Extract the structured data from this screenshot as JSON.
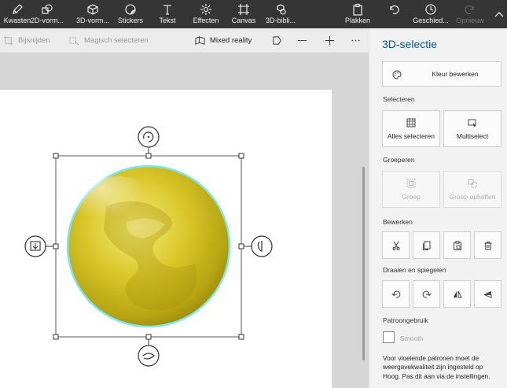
{
  "ribbon": {
    "tools": [
      {
        "label": "Kwasten",
        "icon": "brush-icon"
      },
      {
        "label": "2D-vorm...",
        "icon": "2d-shapes-icon"
      },
      {
        "label": "3D-vorm...",
        "icon": "3d-shapes-icon"
      },
      {
        "label": "Stickers",
        "icon": "sticker-icon"
      },
      {
        "label": "Tekst",
        "icon": "text-icon"
      },
      {
        "label": "Effecten",
        "icon": "effects-icon"
      },
      {
        "label": "Canvas",
        "icon": "canvas-icon"
      },
      {
        "label": "3D-bibli...",
        "icon": "3d-library-icon"
      }
    ],
    "paste": "Plakken",
    "undo": "",
    "history": "Geschied...",
    "redo": "Opnieuw"
  },
  "subbar": {
    "crop": "Bijsnijden",
    "magic_select": "Magisch selecteren",
    "mixed_reality": "Mixed reality"
  },
  "panel": {
    "title": "3D-selectie",
    "edit_color": "Kleur bewerken",
    "select_heading": "Selecteren",
    "select_all": "Alles selecteren",
    "multiselect": "Multiselect",
    "group_heading": "Groeperen",
    "group": "Groep",
    "ungroup": "Groep opheffen",
    "edit_heading": "Bewerken",
    "rotate_heading": "Draaien en spiegelen",
    "pattern_heading": "Patroongebruik",
    "smooth_label": "Smooth",
    "smooth_checked": false,
    "note": "Voor vloeiende patronen moet de weergavekwaliteit zijn ingesteld op Hoog. Pas dit aan via de instellingen."
  },
  "colors": {
    "accent": "#0b5394",
    "sphere": "#d4c41a",
    "sphere_outline": "#7fe6ee",
    "ribbon_bg": "#353535"
  }
}
